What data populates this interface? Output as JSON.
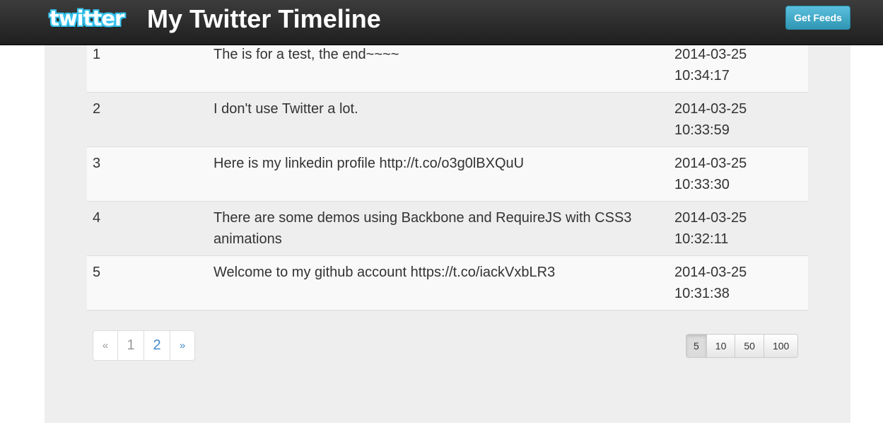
{
  "navbar": {
    "logo_text": "twitter",
    "brand": "My Twitter Timeline",
    "get_feeds_label": "Get Feeds"
  },
  "tweets": [
    {
      "num": "1",
      "text": "The is for a test, the end~~~~",
      "date": "2014-03-25",
      "time": "10:34:17"
    },
    {
      "num": "2",
      "text": "I don't use Twitter a lot.",
      "date": "2014-03-25",
      "time": "10:33:59"
    },
    {
      "num": "3",
      "text": "Here is my linkedin profile http://t.co/o3g0lBXQuU",
      "date": "2014-03-25",
      "time": "10:33:30"
    },
    {
      "num": "4",
      "text": "There are some demos using Backbone and RequireJS with CSS3 animations",
      "date": "2014-03-25",
      "time": "10:32:11"
    },
    {
      "num": "5",
      "text": "Welcome to my github account https://t.co/iackVxbLR3",
      "date": "2014-03-25",
      "time": "10:31:38"
    }
  ],
  "pagination": {
    "prev": "«",
    "pages": [
      "1",
      "2"
    ],
    "next": "»"
  },
  "page_sizes": [
    "5",
    "10",
    "50",
    "100"
  ],
  "colors": {
    "accent": "#5bc0de",
    "link": "#428bca",
    "navbar": "#2b2b2b"
  }
}
